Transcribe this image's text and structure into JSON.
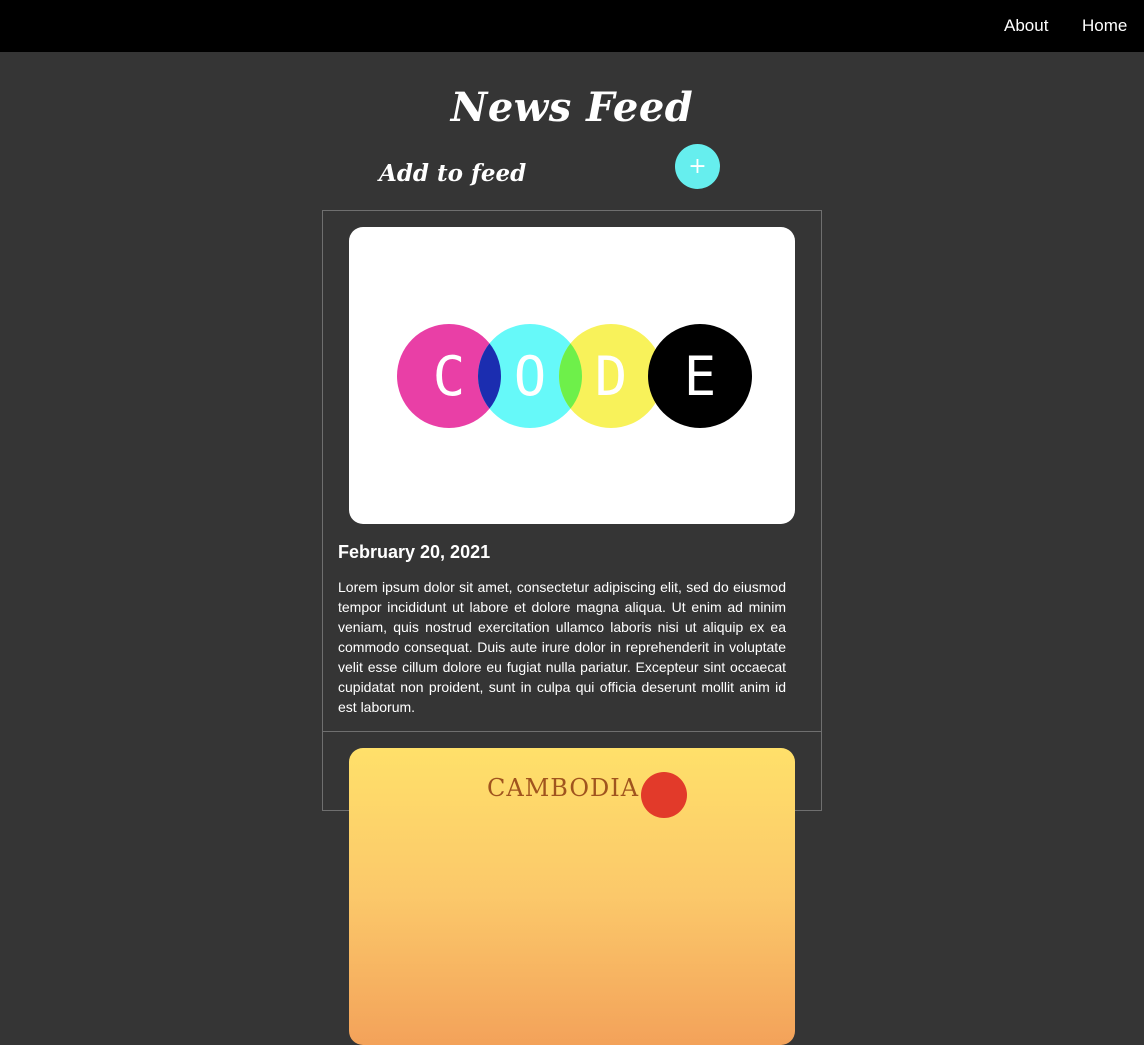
{
  "nav": {
    "about_label": "About",
    "home_label": "Home"
  },
  "header": {
    "title": "News Feed",
    "add_label": "Add to feed",
    "add_button_symbol": "+"
  },
  "posts": [
    {
      "image_icon": "code-logo-image",
      "image_letters": [
        "C",
        "O",
        "D",
        "E"
      ],
      "date": "February 20, 2021",
      "body": "Lorem ipsum dolor sit amet, consectetur adipiscing elit, sed do eiusmod tempor incididunt ut labore et dolore magna aliqua. Ut enim ad minim veniam, quis nostrud exercitation ullamco laboris nisi ut aliquip ex ea commodo consequat. Duis aute irure dolor in reprehenderit in voluptate velit esse cillum dolore eu fugiat nulla pariatur. Excepteur sint occaecat cupidatat non proident, sunt in culpa qui officia deserunt mollit anim id est laborum."
    },
    {
      "image_icon": "cambodia-poster-image",
      "image_text": "CAMBODIA"
    }
  ],
  "colors": {
    "background": "#353535",
    "topbar": "#000000",
    "accent": "#66eeee",
    "magenta": "#e93fa6",
    "cyan": "#66f9f9",
    "yellow": "#f8f25a",
    "black": "#000000"
  }
}
